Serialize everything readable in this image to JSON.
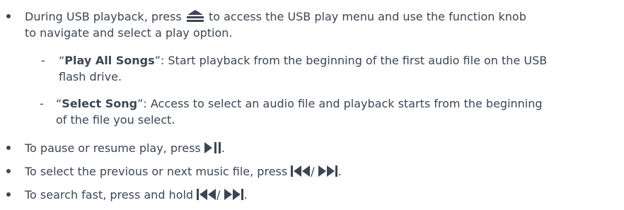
{
  "page": {
    "color": "#3c4654"
  },
  "bullets": [
    {
      "line1_before": "During USB playback, press ",
      "line1_after": " to access the USB play menu and use the function knob",
      "line2": "to navigate and select a play option.",
      "icon": "menu-icon"
    },
    {
      "text_before": "To pause or resume play, press ",
      "icon": "play-pause-icon",
      "text_after": "."
    },
    {
      "text_before": "To select the previous or next music file, press ",
      "icon_a": "previous-track-icon",
      "separator": "/ ",
      "icon_b": "next-track-icon",
      "text_after": "."
    },
    {
      "text_before": "To search fast, press and hold ",
      "icon_a": "previous-track-icon",
      "separator": "/ ",
      "icon_b": "next-track-icon",
      "text_after": "."
    }
  ],
  "options": [
    {
      "dash": "-",
      "open_quote": "“",
      "name": "Play All Songs",
      "close_quote": "”",
      "line1_rest": ": Start playback from the beginning of the first audio file on the USB",
      "line2": "flash drive."
    },
    {
      "dash": "-",
      "open_quote": "“",
      "name": "Select Song",
      "close_quote": "”",
      "line1_rest": ": Access to select an audio file and playback starts from the beginning",
      "line2": "of the file you select."
    }
  ]
}
